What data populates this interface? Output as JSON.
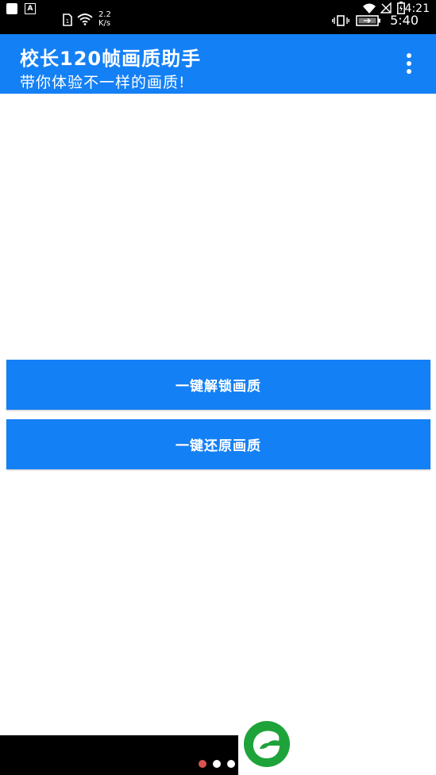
{
  "status_bar": {
    "notification_a": "A",
    "net_speed_value": "2.2",
    "net_speed_unit": "K/s",
    "time_top": "4:21",
    "time_bottom": "5:40",
    "icons": [
      "sim-card-icon",
      "wifi-icon",
      "vibrate-icon",
      "battery-icon",
      "wifi-icon",
      "no-signal-icon",
      "battery-charging-icon"
    ]
  },
  "app_bar": {
    "title": "校长120帧画质助手",
    "subtitle": "带你体验不一样的画质!",
    "color": "#1480f5",
    "menu_icon": "more-vert-icon"
  },
  "buttons": {
    "unlock_label": "一键解锁画质",
    "restore_label": "一键还原画质"
  },
  "pager": {
    "active_color": "#d9534f",
    "count": 3,
    "active_index": 0
  },
  "watermark": {
    "icon": "leaf-logo-icon",
    "color": "#1ea33a"
  }
}
